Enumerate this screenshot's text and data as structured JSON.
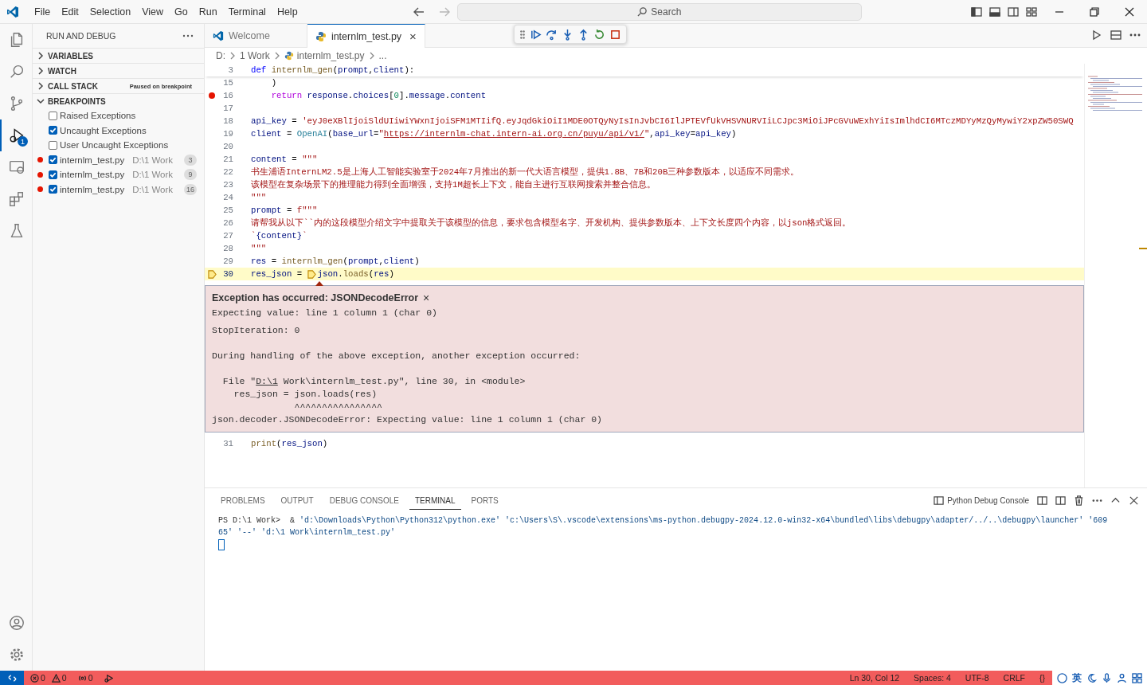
{
  "menu": [
    "File",
    "Edit",
    "Selection",
    "View",
    "Go",
    "Run",
    "Terminal",
    "Help"
  ],
  "search": {
    "placeholder": "Search"
  },
  "activity_bar": [
    {
      "kind": "explorer",
      "selected": false
    },
    {
      "kind": "search",
      "selected": false
    },
    {
      "kind": "scm",
      "selected": false
    },
    {
      "kind": "debug",
      "selected": true,
      "badge": "1"
    },
    {
      "kind": "remote",
      "selected": false
    },
    {
      "kind": "extensions",
      "selected": false
    },
    {
      "kind": "testing",
      "selected": false
    }
  ],
  "sidebar": {
    "title": "RUN AND DEBUG",
    "sections": [
      {
        "label": "VARIABLES",
        "expanded": false
      },
      {
        "label": "WATCH",
        "expanded": false
      },
      {
        "label": "CALL STACK",
        "expanded": false,
        "note": "Paused on breakpoint"
      },
      {
        "label": "BREAKPOINTS",
        "expanded": true
      }
    ],
    "breakpoints": [
      {
        "kind": "exception",
        "label": "Raised Exceptions",
        "checked": false
      },
      {
        "kind": "exception",
        "label": "Uncaught Exceptions",
        "checked": true
      },
      {
        "kind": "exception",
        "label": "User Uncaught Exceptions",
        "checked": false
      },
      {
        "kind": "file",
        "label": "internlm_test.py",
        "path": "D:\\1 Work",
        "line": "3",
        "checked": true
      },
      {
        "kind": "file",
        "label": "internlm_test.py",
        "path": "D:\\1 Work",
        "line": "9",
        "checked": true
      },
      {
        "kind": "file",
        "label": "internlm_test.py",
        "path": "D:\\1 Work",
        "line": "16",
        "checked": true
      }
    ]
  },
  "tabs": [
    {
      "label": "Welcome",
      "kind": "welcome",
      "selected": false
    },
    {
      "label": "internlm_test.py",
      "kind": "python",
      "selected": true,
      "close": "×"
    }
  ],
  "breadcrumb": [
    "D:",
    "1 Work",
    "internlm_test.py",
    "..."
  ],
  "code": [
    {
      "num": "3",
      "sticky": true,
      "tokens": [
        {
          "t": "def ",
          "kind": "kw"
        },
        {
          "t": "internlm_gen",
          "kind": "fn"
        },
        {
          "t": "(",
          "kind": "op"
        },
        {
          "t": "prompt",
          "kind": "var"
        },
        {
          "t": ",",
          "kind": "op"
        },
        {
          "t": "client",
          "kind": "var"
        },
        {
          "t": "):",
          "kind": "op"
        }
      ]
    },
    {
      "num": "15",
      "indented": true,
      "tokens": [
        {
          "t": ")",
          "kind": "op"
        }
      ]
    },
    {
      "num": "16",
      "breakpoint": true,
      "indented": true,
      "tokens": [
        {
          "t": "return ",
          "kind": "ctl"
        },
        {
          "t": "response",
          "kind": "var"
        },
        {
          "t": ".",
          "kind": "op"
        },
        {
          "t": "choices",
          "kind": "var"
        },
        {
          "t": "[",
          "kind": "op"
        },
        {
          "t": "0",
          "kind": "num"
        },
        {
          "t": "].",
          "kind": "op"
        },
        {
          "t": "message",
          "kind": "var"
        },
        {
          "t": ".",
          "kind": "op"
        },
        {
          "t": "content",
          "kind": "var"
        }
      ]
    },
    {
      "num": "17"
    },
    {
      "num": "18",
      "tokens": [
        {
          "t": "api_key",
          "kind": "var"
        },
        {
          "t": " = ",
          "kind": "op"
        },
        {
          "t": "'eyJ0eXBlIjoiSldUIiwiYWxnIjoiSFM1MTIifQ.eyJqdGkiOiI1MDE0OTQyNyIsInJvbCI6IlJPTEVfUkVHSVNURVIiLCJpc3MiOiJPcGVuWExhYiIsImlhdCI6MTczMDYyMzQyMywiY2xpZW50SWQ",
          "kind": "str"
        }
      ]
    },
    {
      "num": "19",
      "tokens": [
        {
          "t": "client",
          "kind": "var"
        },
        {
          "t": " = ",
          "kind": "op"
        },
        {
          "t": "OpenAI",
          "kind": "cls"
        },
        {
          "t": "(",
          "kind": "op"
        },
        {
          "t": "base_url",
          "kind": "var"
        },
        {
          "t": "=",
          "kind": "op"
        },
        {
          "t": "\"",
          "kind": "str"
        },
        {
          "t": "https://internlm-chat.intern-ai.org.cn/puyu/api/v1/",
          "kind": "link"
        },
        {
          "t": "\"",
          "kind": "str"
        },
        {
          "t": ",",
          "kind": "op"
        },
        {
          "t": "api_key",
          "kind": "var"
        },
        {
          "t": "=",
          "kind": "op"
        },
        {
          "t": "api_key",
          "kind": "var"
        },
        {
          "t": ")",
          "kind": "op"
        }
      ]
    },
    {
      "num": "20"
    },
    {
      "num": "21",
      "tokens": [
        {
          "t": "content",
          "kind": "var"
        },
        {
          "t": " = ",
          "kind": "op"
        },
        {
          "t": "\"\"\"",
          "kind": "str"
        }
      ]
    },
    {
      "num": "22",
      "tokens": [
        {
          "t": "书生浦语InternLM2.5是上海人工智能实验室于2024年7月推出的新一代大语言模型，提供1.8B、7B和20B三种参数版本，以适应不同需求。",
          "kind": "str"
        }
      ]
    },
    {
      "num": "23",
      "tokens": [
        {
          "t": "该模型在复杂场景下的推理能力得到全面增强，支持1M超长上下文，能自主进行互联网搜索并整合信息。",
          "kind": "str"
        }
      ]
    },
    {
      "num": "24",
      "tokens": [
        {
          "t": "\"\"\"",
          "kind": "str"
        }
      ]
    },
    {
      "num": "25",
      "tokens": [
        {
          "t": "prompt",
          "kind": "var"
        },
        {
          "t": " = ",
          "kind": "op"
        },
        {
          "t": "f\"\"\"",
          "kind": "str"
        }
      ]
    },
    {
      "num": "26",
      "tokens": [
        {
          "t": "请帮我从以下``内的这段模型介绍文字中提取关于该模型的信息，要求包含模型名字、开发机构、提供参数版本、上下文长度四个内容，以json格式返回。",
          "kind": "str"
        }
      ]
    },
    {
      "num": "27",
      "tokens": [
        {
          "t": "`",
          "kind": "str"
        },
        {
          "t": "{content}",
          "kind": "var"
        },
        {
          "t": "`",
          "kind": "str"
        }
      ]
    },
    {
      "num": "28",
      "tokens": [
        {
          "t": "\"\"\"",
          "kind": "str"
        }
      ]
    },
    {
      "num": "29",
      "tokens": [
        {
          "t": "res",
          "kind": "var"
        },
        {
          "t": " = ",
          "kind": "op"
        },
        {
          "t": "internlm_gen",
          "kind": "fn"
        },
        {
          "t": "(",
          "kind": "op"
        },
        {
          "t": "prompt",
          "kind": "var"
        },
        {
          "t": ",",
          "kind": "op"
        },
        {
          "t": "client",
          "kind": "var"
        },
        {
          "t": ")",
          "kind": "op"
        }
      ]
    },
    {
      "num": "30",
      "current": true,
      "tokens": [
        {
          "t": "res_json",
          "kind": "var"
        },
        {
          "t": " = ",
          "kind": "op"
        },
        {
          "t": "json",
          "kind": "var",
          "stop": true
        },
        {
          "t": ".",
          "kind": "op"
        },
        {
          "t": "loads",
          "kind": "fn"
        },
        {
          "t": "(",
          "kind": "op"
        },
        {
          "t": "res",
          "kind": "var"
        },
        {
          "t": ")",
          "kind": "op"
        }
      ]
    },
    {
      "num": "31",
      "after_exception": true,
      "tokens": [
        {
          "t": "print",
          "kind": "fn"
        },
        {
          "t": "(",
          "kind": "op"
        },
        {
          "t": "res_json",
          "kind": "var"
        },
        {
          "t": ")",
          "kind": "op"
        }
      ]
    }
  ],
  "exception": {
    "title": "Exception has occurred: JSONDecodeError",
    "close": "×",
    "lines": [
      {
        "text": "Expecting value: line 1 column 1 (char 0)"
      },
      {
        "text": "StopIteration: 0",
        "space_before": true
      },
      {
        "text": "During handling of the above exception, another exception occurred:",
        "space_before": true
      },
      {
        "kind": "file",
        "before": "  File \"",
        "link": "D:\\1",
        "after": " Work\\internlm_test.py\", line 30, in <module>",
        "space_before": true
      },
      {
        "text": "    res_json = json.loads(res)"
      },
      {
        "text": "               ^^^^^^^^^^^^^^^^"
      },
      {
        "text": "json.decoder.JSONDecodeError: Expecting value: line 1 column 1 (char 0)"
      }
    ]
  },
  "panel": {
    "tabs": [
      {
        "label": "PROBLEMS",
        "selected": false
      },
      {
        "label": "OUTPUT",
        "selected": false
      },
      {
        "label": "DEBUG CONSOLE",
        "selected": false
      },
      {
        "label": "TERMINAL",
        "selected": true
      },
      {
        "label": "PORTS",
        "selected": false
      }
    ],
    "terminal_name": "Python Debug Console",
    "terminal": [
      [
        {
          "t": "PS D:\\1 Work>  & ",
          "kind": "plain"
        },
        {
          "t": "'d:\\Downloads\\Python\\Python312\\python.exe' 'c:\\Users\\S\\.vscode\\extensions\\ms-python.debugpy-2024.12.0-win32-x64\\bundled\\libs\\debugpy\\adapter/../..\\debugpy\\launcher' '609",
          "kind": "str"
        }
      ],
      [
        {
          "t": "65' '--' 'd:\\1 Work\\internlm_test.py'",
          "kind": "str"
        }
      ]
    ]
  },
  "status_bar": {
    "left": [
      {
        "kind": "remote"
      },
      {
        "kind": "errors",
        "text": "0"
      },
      {
        "kind": "warnings",
        "text": "0"
      },
      {
        "kind": "ports",
        "text": "0"
      },
      {
        "kind": "debug"
      }
    ],
    "right": [
      "Ln 30, Col 12",
      "Spaces: 4",
      "UTF-8",
      "CRLF",
      "{}"
    ],
    "ime": "英"
  }
}
